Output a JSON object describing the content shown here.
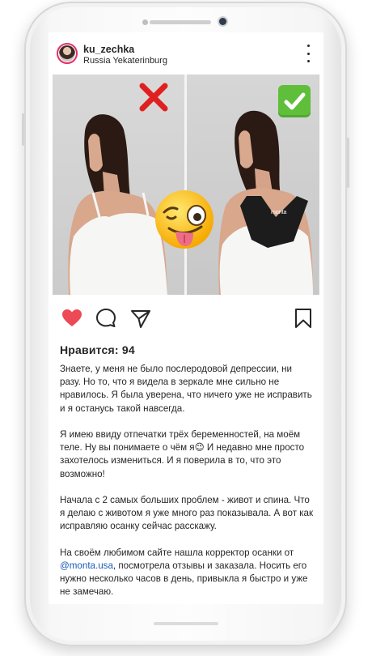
{
  "post": {
    "username": "ku_zechka",
    "location": "Russia Yekaterinburg",
    "likes_text": "Нравится: 94",
    "caption": {
      "p1": "Знаете, у меня не было послеродовой депрессии, ни разу. Но то, что я видела в зеркале мне сильно не нравилось. Я была уверена, что ничего уже не исправить и я останусь такой навсегда.",
      "p2": "Я имею ввиду отпечатки трёх беременностей, на моём теле. Ну вы понимаете о чём я😉 И недавно мне просто захотелось измениться. И я поверила в то, что это возможно!",
      "p3": "Начала с 2 самых больших проблем - живот и спина. Что я делаю с животом я уже много раз показывала. А вот как исправляю осанку сейчас расскажу.",
      "p4_before": "На своём любимом сайте нашла корректор осанки от ",
      "p4_mention": "@monta.usa",
      "p4_after": ", посмотрела отзывы и заказала. Носить его нужно несколько часов в день, привыкла я быстро и уже не замечаю."
    },
    "image": {
      "brace_label": "monta"
    }
  },
  "icons": {
    "like": "heart-icon-filled",
    "comment": "comment-icon",
    "share": "share-icon",
    "save": "bookmark-icon",
    "more": "more-options-icon",
    "cross": "cross-mark-icon",
    "check": "check-mark-icon",
    "emoji": "winking-face-tongue-emoji"
  },
  "colors": {
    "like": "#ed4956",
    "mention": "#1a5bb8",
    "check_bg": "#5fbf3b",
    "cross": "#e02020"
  }
}
